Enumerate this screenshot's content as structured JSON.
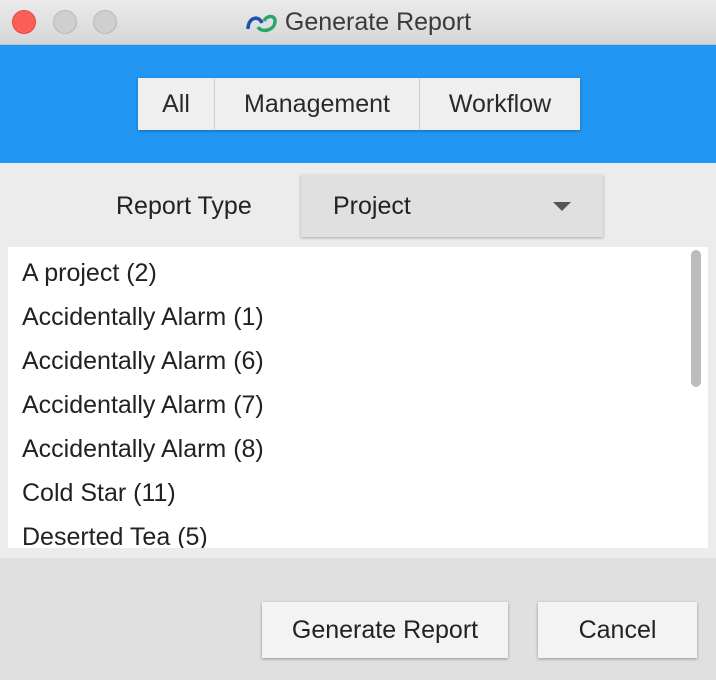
{
  "window": {
    "title": "Generate Report"
  },
  "filters": {
    "all": "All",
    "management": "Management",
    "workflow": "Workflow"
  },
  "report_type": {
    "label": "Report Type",
    "selected": "Project"
  },
  "projects": [
    "A project (2)",
    "Accidentally Alarm (1)",
    "Accidentally Alarm (6)",
    "Accidentally Alarm (7)",
    "Accidentally Alarm (8)",
    "Cold Star (11)",
    "Deserted Tea (5)"
  ],
  "actions": {
    "generate": "Generate Report",
    "cancel": "Cancel"
  },
  "colors": {
    "header": "#2196f3",
    "close": "#fc5f57"
  }
}
